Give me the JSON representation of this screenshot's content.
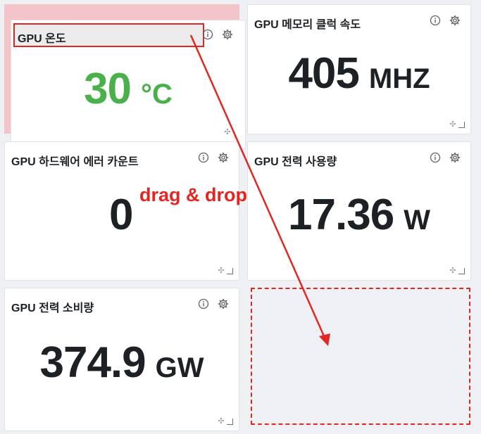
{
  "cards": {
    "temperature": {
      "title": "GPU 온도",
      "value": "30",
      "unit": "°C"
    },
    "memory_clock": {
      "title": "GPU 메모리 클럭 속도",
      "value": "405",
      "unit": "MHZ"
    },
    "hw_errors": {
      "title": "GPU 하드웨어 에러 카운트",
      "value": "0",
      "unit": ""
    },
    "power_usage": {
      "title": "GPU 전력 사용량",
      "value": "17.36",
      "unit": "W"
    },
    "power_consumption": {
      "title": "GPU 전력 소비량",
      "value": "374.9",
      "unit": "GW"
    }
  },
  "annotation": {
    "drag_label": "drag & drop"
  },
  "colors": {
    "accent_red": "#e42622",
    "value_green": "#4ab04a",
    "placeholder_pink": "#f4c4cb"
  },
  "icons": {
    "info": "info-icon",
    "settings": "gear-icon",
    "move": "move-icon",
    "resize": "resize-handle-icon"
  }
}
